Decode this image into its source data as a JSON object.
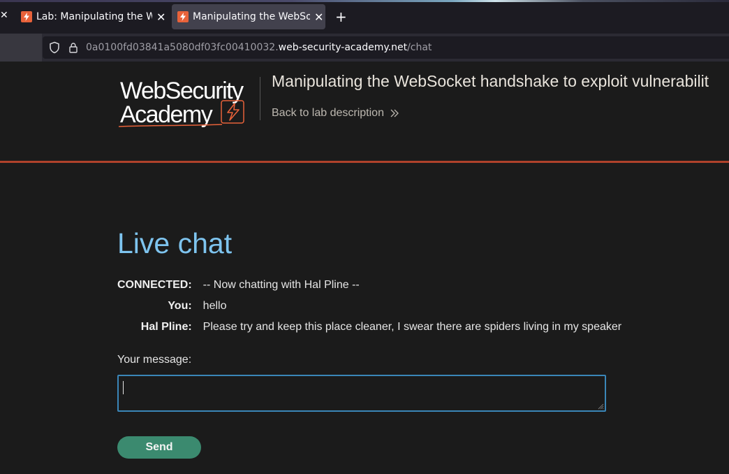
{
  "browser": {
    "tabs": [
      {
        "title": "Lab: Manipulating the We",
        "active": false
      },
      {
        "title": "Manipulating the WebSoc",
        "active": true
      }
    ],
    "close_glyph": "✕",
    "new_tab_glyph": "+",
    "url": {
      "subdomain": "0a0100fd03841a5080df03fc00410032.",
      "host": "web-security-academy.net",
      "path": "/chat"
    }
  },
  "header": {
    "logo_line1": "WebSecurity",
    "logo_line2": "Academy",
    "lab_title": "Manipulating the WebSocket handshake to exploit vulnerabilit",
    "back_link": "Back to lab description"
  },
  "chat": {
    "title": "Live chat",
    "messages": [
      {
        "who": "CONNECTED:",
        "text": "-- Now chatting with Hal Pline --"
      },
      {
        "who": "You:",
        "text": "hello"
      },
      {
        "who": "Hal Pline:",
        "text": "Please try and keep this place cleaner, I swear there are spiders living in my speaker"
      }
    ],
    "input_label": "Your message:",
    "input_value": "",
    "send_label": "Send"
  },
  "colors": {
    "accent_orange": "#e8623a",
    "header_divider": "#b0422b",
    "title_blue": "#7ec4ef",
    "send_green": "#3b8a6f",
    "input_border": "#3a86b8"
  }
}
